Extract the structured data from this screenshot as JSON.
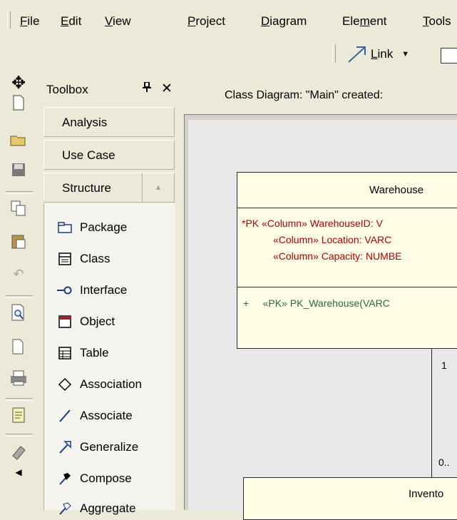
{
  "menubar": {
    "items": [
      {
        "pre": "",
        "ul": "F",
        "post": "ile"
      },
      {
        "pre": "",
        "ul": "E",
        "post": "dit"
      },
      {
        "pre": "",
        "ul": "V",
        "post": "iew"
      },
      {
        "pre": "",
        "ul": "P",
        "post": "roject"
      },
      {
        "pre": "",
        "ul": "D",
        "post": "iagram"
      },
      {
        "pre": "Ele",
        "ul": "m",
        "post": "ent"
      },
      {
        "pre": "",
        "ul": "T",
        "post": "ools"
      }
    ]
  },
  "toolbar": {
    "link_pre": "",
    "link_ul": "L",
    "link_post": "ink",
    "link_dropdown": "▼"
  },
  "left_toolbar": {
    "icons": [
      "move-icon",
      "new-icon",
      "open-folder-icon",
      "save-icon",
      "copy-icon",
      "paste-icon",
      "undo-icon",
      "print-preview-icon",
      "page-icon",
      "print-icon",
      "notes-icon",
      "book-icon",
      "arrow-left-icon"
    ]
  },
  "toolbox": {
    "title": "Toolbox",
    "pin": "ᵽ",
    "close": "✕",
    "categories": [
      "Analysis",
      "Use Case",
      "Structure"
    ],
    "scroll_up": "▲",
    "items": [
      {
        "label": "Package",
        "icon": "package-icon"
      },
      {
        "label": "Class",
        "icon": "class-icon"
      },
      {
        "label": "Interface",
        "icon": "interface-icon"
      },
      {
        "label": "Object",
        "icon": "object-icon"
      },
      {
        "label": "Table",
        "icon": "table-icon"
      },
      {
        "label": "Association",
        "icon": "association-icon"
      },
      {
        "label": "Associate",
        "icon": "associate-icon"
      },
      {
        "label": "Generalize",
        "icon": "generalize-icon"
      },
      {
        "label": "Compose",
        "icon": "compose-icon"
      },
      {
        "label": "Aggregate",
        "icon": "aggregate-icon"
      }
    ]
  },
  "diagram": {
    "header": "Class Diagram: \"Main\"  created:",
    "warehouse": {
      "name": "Warehouse",
      "attrs": [
        "*PK «Column» WarehouseID:  V",
        "«Column» Location:  VARC",
        "«Column» Capacity:  NUMBE"
      ],
      "ops": [
        "+     «PK» PK_Warehouse(VARC"
      ]
    },
    "inventory": {
      "name": "Invento"
    },
    "mult_top": "1",
    "mult_bottom": "0.."
  }
}
